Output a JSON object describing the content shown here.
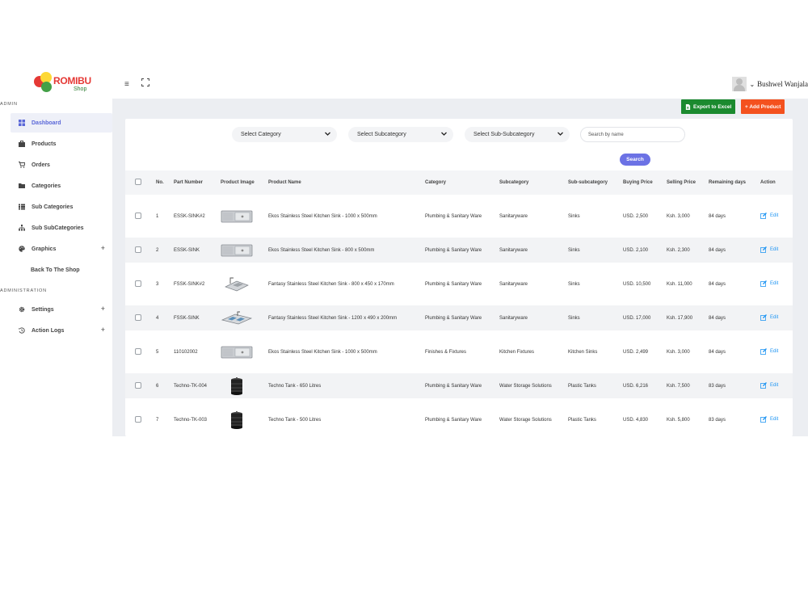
{
  "brand": {
    "name": "ROMIBU",
    "sub": "Shop"
  },
  "sidebar": {
    "sections": [
      {
        "title": "ADMIN",
        "items": [
          {
            "label": "Dashboard",
            "icon": "grid-icon",
            "active": true
          },
          {
            "label": "Products",
            "icon": "briefcase-icon"
          },
          {
            "label": "Orders",
            "icon": "cart-icon"
          },
          {
            "label": "Categories",
            "icon": "folder-icon"
          },
          {
            "label": "Sub Categories",
            "icon": "list-icon"
          },
          {
            "label": "Sub SubCategories",
            "icon": "sitemap-icon"
          },
          {
            "label": "Graphics",
            "icon": "palette-icon",
            "plus": "+"
          },
          {
            "label": "Back To The Shop"
          }
        ]
      },
      {
        "title": "ADMINISTRATION",
        "items": [
          {
            "label": "Settings",
            "icon": "cog-icon",
            "plus": "+"
          },
          {
            "label": "Action Logs",
            "icon": "history-icon",
            "plus": "+"
          }
        ]
      }
    ]
  },
  "topbar": {
    "user_name": "Bushwel Wanjala"
  },
  "toolbar": {
    "export_label": "Export to Excel",
    "add_label": "+ Add Product"
  },
  "filters": {
    "category": "Select Category",
    "subcategory": "Select Subcategory",
    "subsubcategory": "Select Sub-Subcategory",
    "search_placeholder": "Search by name",
    "search_button": "Search"
  },
  "table": {
    "columns": [
      "No.",
      "Part Number",
      "Product Image",
      "Product Name",
      "Category",
      "Subcategory",
      "Sub-subcategory",
      "Buying Price",
      "Selling Price",
      "Remaining days",
      "Action"
    ],
    "rows": [
      {
        "no": "1",
        "part": "ESSK-SINK#2",
        "img": "sink-single",
        "name": "Ekos Stainless Steel Kitchen Sink - 1000 x 500mm",
        "category": "Plumbing & Sanitary Ware",
        "subcategory": "Sanitaryware",
        "subsub": "Sinks",
        "buy": "USD. 2,500",
        "sell": "Ksh. 3,000",
        "days": "84 days",
        "action": "Edit"
      },
      {
        "no": "2",
        "part": "ESSK-SINK",
        "img": "sink-single",
        "name": "Ekos Stainless Steel Kitchen Sink - 800 x 500mm",
        "category": "Plumbing & Sanitary Ware",
        "subcategory": "Sanitaryware",
        "subsub": "Sinks",
        "buy": "USD. 2,100",
        "sell": "Ksh. 2,300",
        "days": "84 days",
        "action": "Edit"
      },
      {
        "no": "3",
        "part": "FSSK-SINK#2",
        "img": "sink-angle",
        "name": "Fantasy Stainless Steel Kitchen Sink - 800 x 450 x 170mm",
        "category": "Plumbing & Sanitary Ware",
        "subcategory": "Sanitaryware",
        "subsub": "Sinks",
        "buy": "USD. 10,500",
        "sell": "Ksh. 11,000",
        "days": "84 days",
        "action": "Edit"
      },
      {
        "no": "4",
        "part": "FSSK-SINK",
        "img": "sink-double",
        "name": "Fantasy Stainless Steel Kitchen Sink - 1200 x 490 x 200mm",
        "category": "Plumbing & Sanitary Ware",
        "subcategory": "Sanitaryware",
        "subsub": "Sinks",
        "buy": "USD. 17,000",
        "sell": "Ksh. 17,900",
        "days": "84 days",
        "action": "Edit"
      },
      {
        "no": "5",
        "part": "110102002",
        "img": "sink-single",
        "name": "Ekos Stainless Steel Kitchen Sink - 1000 x 500mm",
        "category": "Finishes & Fixtures",
        "subcategory": "Kitchen Fixtures",
        "subsub": "Kitchen Sinks",
        "buy": "USD. 2,499",
        "sell": "Ksh. 3,000",
        "days": "84 days",
        "action": "Edit"
      },
      {
        "no": "6",
        "part": "Techno-TK-004",
        "img": "tank",
        "name": "Techno Tank - 650 Litres",
        "category": "Plumbing & Sanitary Ware",
        "subcategory": "Water Storage Solutions",
        "subsub": "Plastic Tanks",
        "buy": "USD. 6,216",
        "sell": "Ksh. 7,500",
        "days": "83 days",
        "action": "Edit"
      },
      {
        "no": "7",
        "part": "Techno-TK-003",
        "img": "tank",
        "name": "Techno Tank - 500 Litres",
        "category": "Plumbing & Sanitary Ware",
        "subcategory": "Water Storage Solutions",
        "subsub": "Plastic Tanks",
        "buy": "USD. 4,830",
        "sell": "Ksh. 5,800",
        "days": "83 days",
        "action": "Edit"
      }
    ]
  },
  "colors": {
    "accent": "#5a67d8",
    "export": "#1b8a2f",
    "add": "#f4511e",
    "search": "#6c72e5",
    "edit": "#2196f3"
  }
}
